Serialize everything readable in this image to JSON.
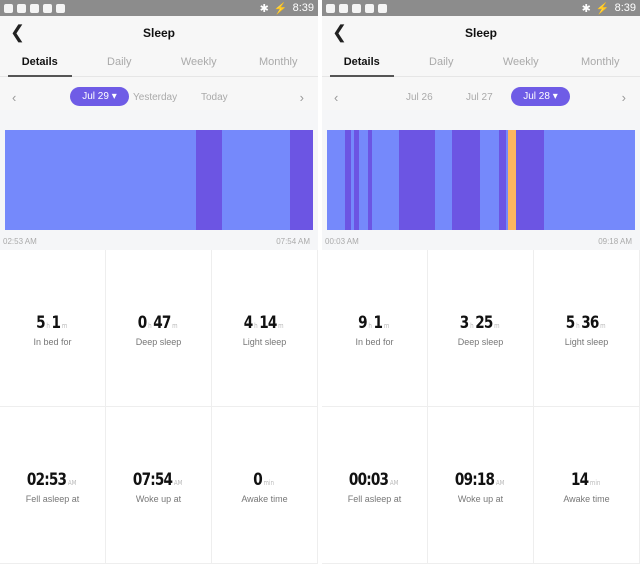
{
  "colors": {
    "light": "#7589fb",
    "deep": "#6c55e3",
    "awake": "#fdb55f",
    "accent": "#6f5ce6"
  },
  "status_time": "8:39",
  "panels": [
    {
      "title": "Sleep",
      "tabs": [
        "Details",
        "Daily",
        "Weekly",
        "Monthly"
      ],
      "active_tab": 0,
      "dates": {
        "selected": "Jul 29 ▾",
        "others": [
          "Yesterday",
          "Today"
        ]
      },
      "chart": {
        "start": "02:53 AM",
        "end": "07:54 AM",
        "segments": [
          {
            "stage": "light",
            "minutes": 187
          },
          {
            "stage": "deep",
            "minutes": 25
          },
          {
            "stage": "light",
            "minutes": 67
          },
          {
            "stage": "deep",
            "minutes": 22
          }
        ]
      },
      "stats": [
        {
          "value": "5",
          "u1": "h",
          "value2": "1",
          "u2": "m",
          "label": "In bed for"
        },
        {
          "value": "0",
          "u1": "h",
          "value2": "47",
          "u2": "m",
          "label": "Deep sleep"
        },
        {
          "value": "4",
          "u1": "h",
          "value2": "14",
          "u2": "m",
          "label": "Light sleep"
        },
        {
          "value": "02:53",
          "u1": "AM",
          "label": "Fell asleep at"
        },
        {
          "value": "07:54",
          "u1": "AM",
          "label": "Woke up at"
        },
        {
          "value": "0",
          "u1": "min",
          "label": "Awake time"
        }
      ]
    },
    {
      "title": "Sleep",
      "tabs": [
        "Details",
        "Daily",
        "Weekly",
        "Monthly"
      ],
      "active_tab": 0,
      "dates": {
        "selected": "Jul 28 ▾",
        "others": [
          "Jul 26",
          "Jul 27"
        ]
      },
      "chart": {
        "start": "00:03 AM",
        "end": "09:18 AM",
        "segments": [
          {
            "stage": "light",
            "minutes": 33
          },
          {
            "stage": "deep",
            "minutes": 11
          },
          {
            "stage": "light",
            "minutes": 5
          },
          {
            "stage": "deep",
            "minutes": 9
          },
          {
            "stage": "light",
            "minutes": 16
          },
          {
            "stage": "deep",
            "minutes": 7
          },
          {
            "stage": "light",
            "minutes": 49
          },
          {
            "stage": "deep",
            "minutes": 65
          },
          {
            "stage": "light",
            "minutes": 31
          },
          {
            "stage": "deep",
            "minutes": 49
          },
          {
            "stage": "light",
            "minutes": 34
          },
          {
            "stage": "deep",
            "minutes": 13
          },
          {
            "stage": "light",
            "minutes": 4
          },
          {
            "stage": "awake",
            "minutes": 14
          },
          {
            "stage": "deep",
            "minutes": 51
          },
          {
            "stage": "light",
            "minutes": 164
          }
        ]
      },
      "stats": [
        {
          "value": "9",
          "u1": "h",
          "value2": "1",
          "u2": "m",
          "label": "In bed for"
        },
        {
          "value": "3",
          "u1": "h",
          "value2": "25",
          "u2": "m",
          "label": "Deep sleep"
        },
        {
          "value": "5",
          "u1": "h",
          "value2": "36",
          "u2": "m",
          "label": "Light sleep"
        },
        {
          "value": "00:03",
          "u1": "AM",
          "label": "Fell asleep at"
        },
        {
          "value": "09:18",
          "u1": "AM",
          "label": "Woke up at"
        },
        {
          "value": "14",
          "u1": "min",
          "label": "Awake time"
        }
      ]
    }
  ]
}
